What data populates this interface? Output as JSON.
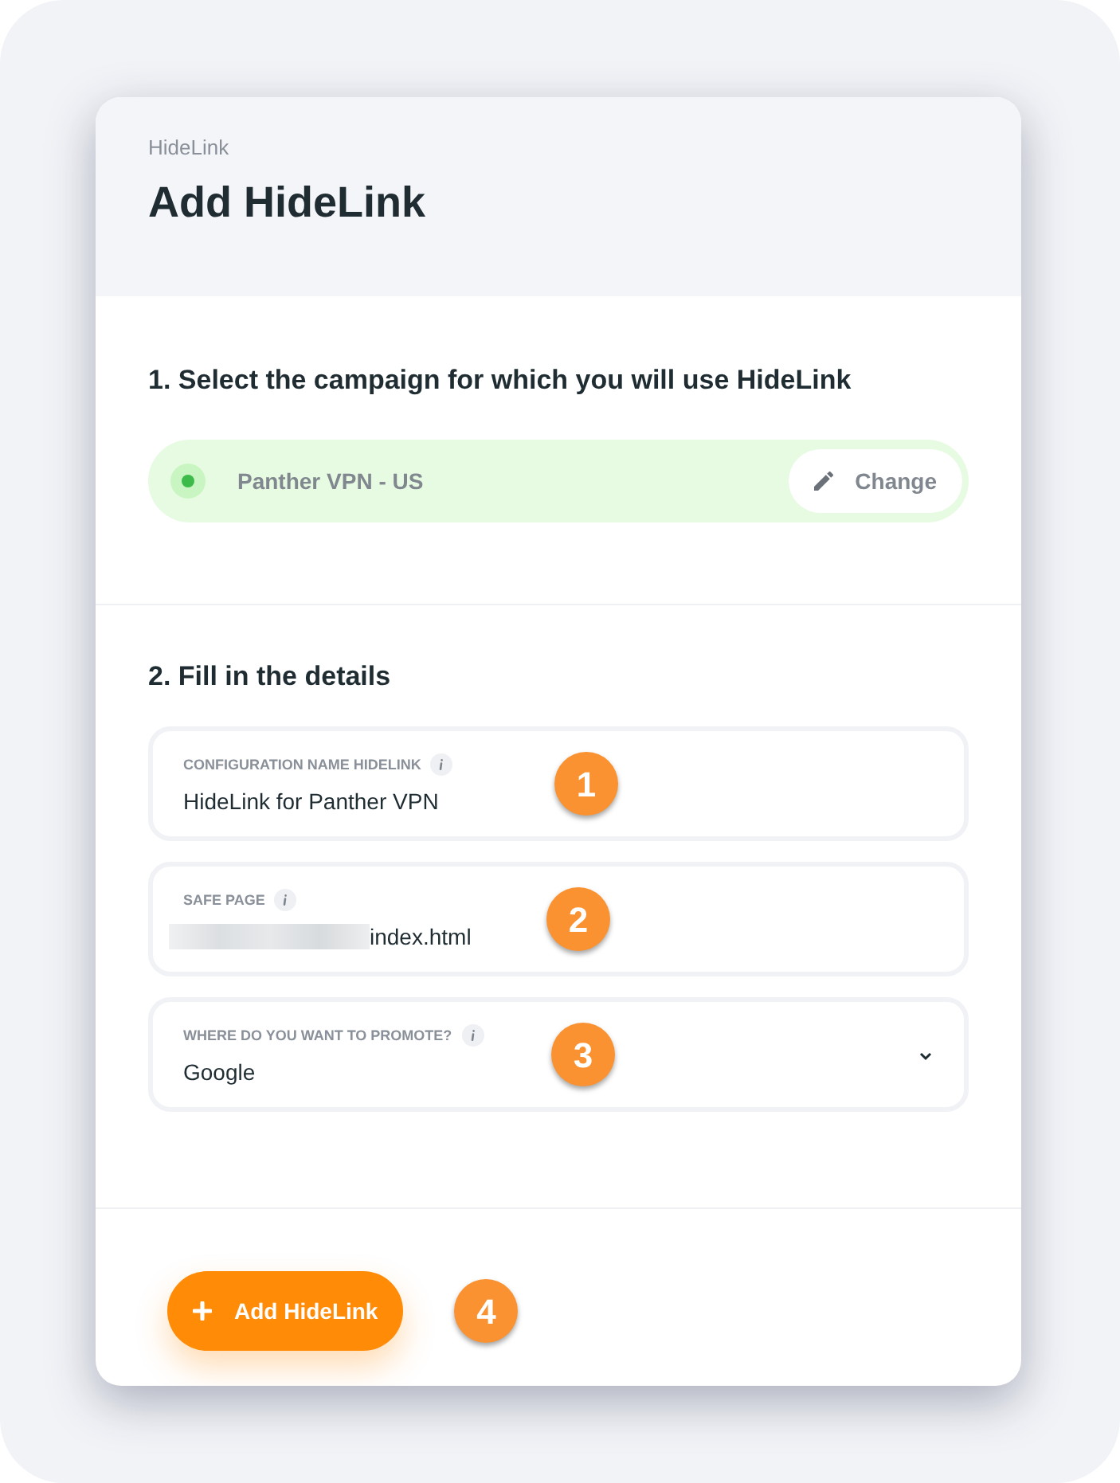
{
  "header": {
    "breadcrumb": "HideLink",
    "title": "Add HideLink"
  },
  "campaign_section": {
    "heading": "1. Select the campaign for which you will use HideLink",
    "campaign": {
      "name": "Panther VPN - US",
      "color": "#3dbb4a"
    },
    "change_button": "Change"
  },
  "details_section": {
    "heading": "2. Fill in the details",
    "fields": [
      {
        "kind": "text",
        "label": "CONFIGURATION NAME HIDELINK",
        "value": "HideLink for Panther VPN",
        "redacted": false,
        "annotation": "1"
      },
      {
        "kind": "text",
        "label": "SAFE PAGE",
        "value": "index.html",
        "redacted": true,
        "annotation": "2"
      },
      {
        "kind": "select",
        "label": "WHERE DO YOU WANT TO PROMOTE?",
        "value": "Google",
        "redacted": false,
        "annotation": "3"
      }
    ]
  },
  "submit": {
    "label": "Add HideLink",
    "annotation": "4"
  }
}
